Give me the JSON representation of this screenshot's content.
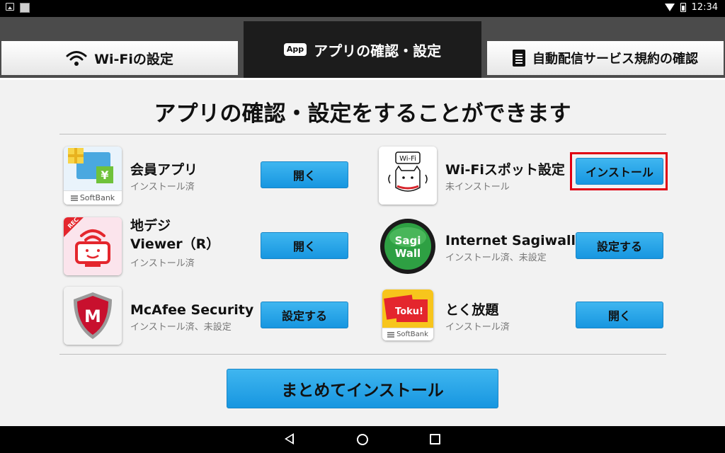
{
  "statusbar": {
    "time": "12:34"
  },
  "tabs": {
    "wifi": {
      "label": "Wi-Fiの設定"
    },
    "apps": {
      "badge": "App",
      "label": "アプリの確認・設定"
    },
    "terms": {
      "label": "自動配信サービス規約の確認"
    }
  },
  "heading": "アプリの確認・設定をすることができます",
  "apps": [
    {
      "name": "会員アプリ",
      "status": "インストール済",
      "button": "開く",
      "icon_label": "SoftBank"
    },
    {
      "name_line1": "地デジ",
      "name_line2": "Viewer（R）",
      "status": "インストール済",
      "button": "開く",
      "icon_badge": "REC"
    },
    {
      "name": "McAfee Security",
      "status": "インストール済、未設定",
      "button": "設定する",
      "icon_letter": "M"
    },
    {
      "name": "Wi-Fiスポット設定",
      "status": "未インストール",
      "button": "インストール",
      "icon_label": "Wi-Fi",
      "highlighted": true
    },
    {
      "name": "Internet Sagiwall",
      "status": "インストール済、未設定",
      "button": "設定する",
      "icon_line1": "Sagi",
      "icon_line2": "Wall"
    },
    {
      "name": "とく放題",
      "status": "インストール済",
      "button": "開く",
      "icon_label": "Toku!",
      "icon_footer": "SoftBank"
    }
  ],
  "install_all_button": "まとめてインストール",
  "colors": {
    "button": "#1796e0",
    "highlight": "#e00012",
    "tab_active": "#1c1c1c"
  }
}
